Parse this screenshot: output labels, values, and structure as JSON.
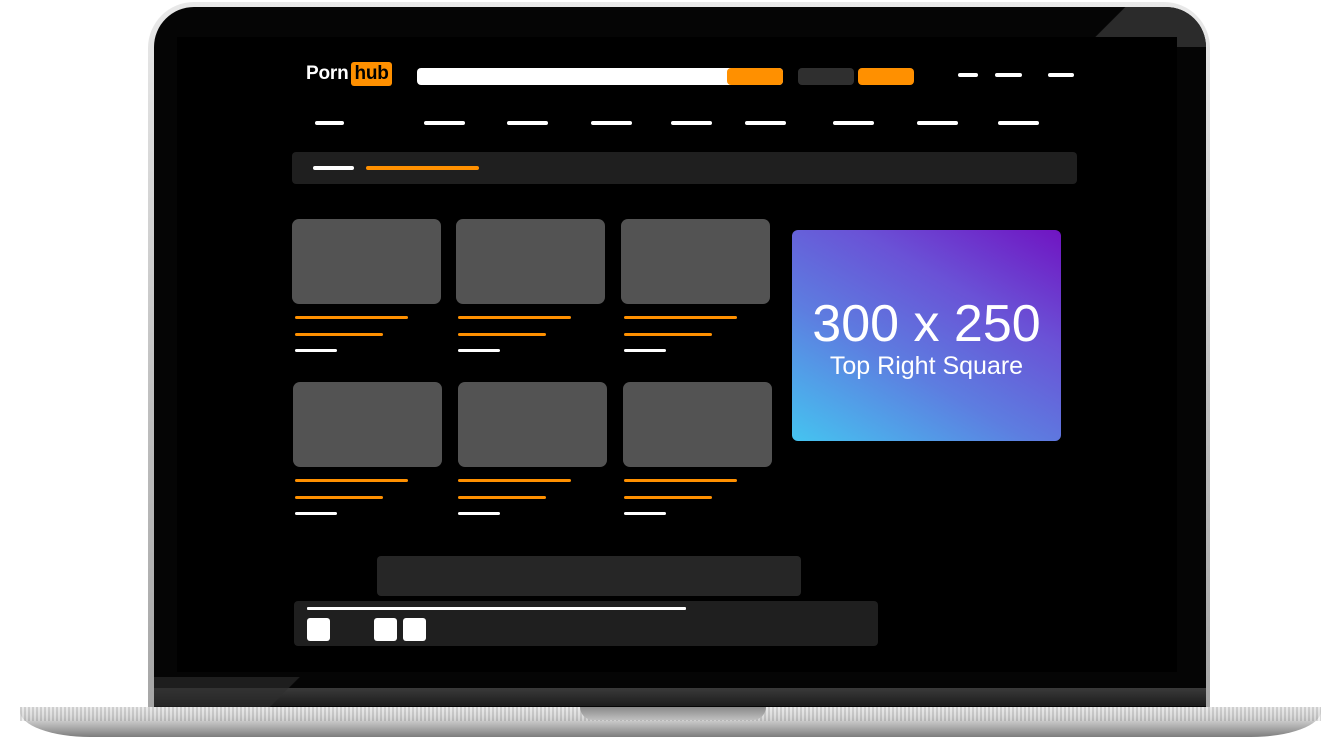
{
  "logo": {
    "part1": "Porn",
    "part2": "hub",
    "accent_color": "#ff9000"
  },
  "ad": {
    "size_label": "300 x 250",
    "position_label": "Top Right Square"
  },
  "colors": {
    "background": "#000000",
    "placeholder_gray": "#535353",
    "panel_dark": "#1f1f1f",
    "accent": "#ff9000",
    "text": "#ffffff"
  }
}
